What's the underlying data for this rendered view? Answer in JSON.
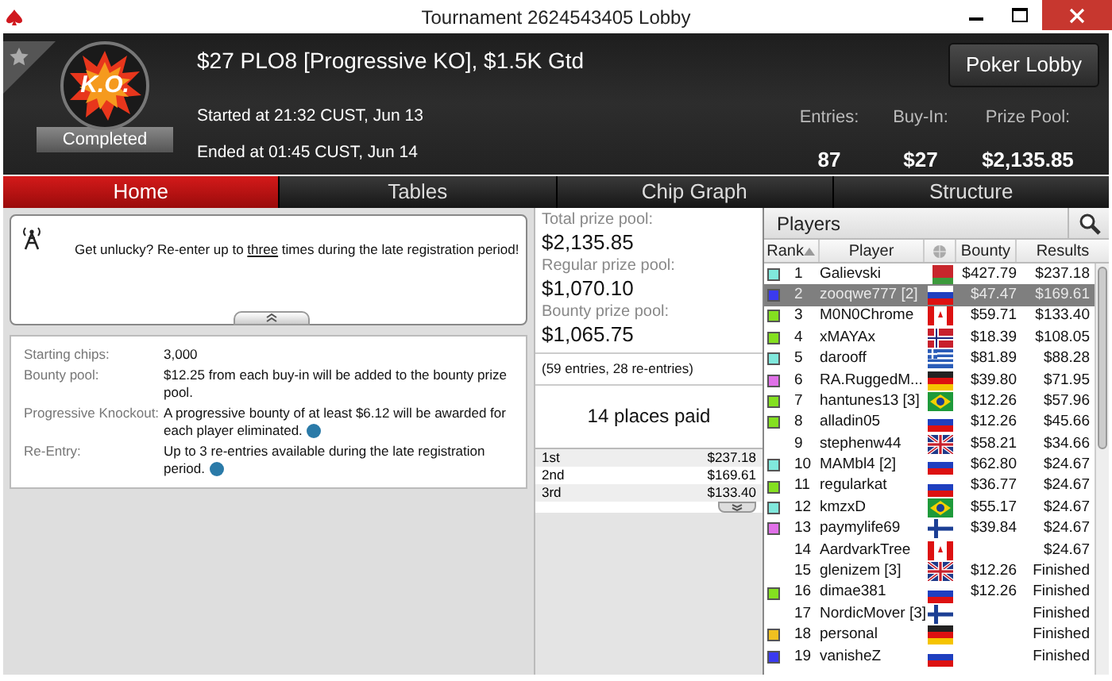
{
  "window": {
    "title": "Tournament 2624543405 Lobby"
  },
  "header": {
    "name": "$27 PLO8 [Progressive KO], $1.5K Gtd",
    "logo_text": "K.O.",
    "status": "Completed",
    "started": "Started at 21:32 CUST, Jun 13",
    "ended": "Ended at 01:45 CUST, Jun 14",
    "stats": [
      {
        "label": "Entries:",
        "value": "87"
      },
      {
        "label": "Buy-In:",
        "value": "$27"
      },
      {
        "label": "Prize Pool:",
        "value": "$2,135.85"
      }
    ],
    "button": "Poker Lobby"
  },
  "tabs": [
    {
      "label": "Home",
      "selected": true
    },
    {
      "label": "Tables",
      "selected": false
    },
    {
      "label": "Chip Graph",
      "selected": false
    },
    {
      "label": "Structure",
      "selected": false
    }
  ],
  "notice_parts": [
    "Get unlucky? Re-enter up to ",
    "three",
    " times during the late registration period!"
  ],
  "details": [
    {
      "label": "Starting chips:",
      "value": "3,000",
      "info": false
    },
    {
      "label": "Bounty pool:",
      "value": "$12.25 from each buy-in will be added to the bounty prize pool.",
      "info": false
    },
    {
      "label": "Progressive Knockout:",
      "value": "A progressive bounty of at least $6.12 will be awarded for each player eliminated.",
      "info": true
    },
    {
      "label": "Re-Entry:",
      "value": "Up to 3 re-entries available during the late registration period.",
      "info": true
    }
  ],
  "prizes": [
    {
      "label": "Total prize pool:",
      "value": "$2,135.85"
    },
    {
      "label": "Regular prize pool:",
      "value": "$1,070.10"
    },
    {
      "label": "Bounty prize pool:",
      "value": "$1,065.75"
    }
  ],
  "entries_note": "(59 entries, 28 re-entries)",
  "places_paid": "14 places paid",
  "payouts": [
    {
      "place": "1st",
      "amount": "$237.18"
    },
    {
      "place": "2nd",
      "amount": "$169.61"
    },
    {
      "place": "3rd",
      "amount": "$133.40"
    }
  ],
  "players": {
    "title": "Players",
    "columns": [
      "Rank",
      "Player",
      "Bounty",
      "Results"
    ],
    "rows": [
      {
        "rank": "1",
        "player": "Galievski",
        "kind": "by",
        "bounty": "$427.79",
        "result": "$237.18",
        "color": "#80e8dc",
        "selected": false
      },
      {
        "rank": "2",
        "player": "zooqwe777 [2]",
        "kind": "ru",
        "bounty": "$47.47",
        "result": "$169.61",
        "color": "#3a3af0",
        "selected": true
      },
      {
        "rank": "3",
        "player": "M0N0Chrome",
        "kind": "ca",
        "bounty": "$59.71",
        "result": "$133.40",
        "color": "#84e020",
        "selected": false
      },
      {
        "rank": "4",
        "player": "xMAYAx",
        "kind": "no",
        "bounty": "$18.39",
        "result": "$108.05",
        "color": "#84e020",
        "selected": false
      },
      {
        "rank": "5",
        "player": "darooff",
        "kind": "gr",
        "bounty": "$81.89",
        "result": "$88.28",
        "color": "#80e8dc",
        "selected": false
      },
      {
        "rank": "6",
        "player": "RA.RuggedM...",
        "kind": "de",
        "bounty": "$39.80",
        "result": "$71.95",
        "color": "#e070e8",
        "selected": false
      },
      {
        "rank": "7",
        "player": "hantunes13 [3]",
        "kind": "br",
        "bounty": "$12.26",
        "result": "$57.96",
        "color": "#84e020",
        "selected": false
      },
      {
        "rank": "8",
        "player": "alladin05",
        "kind": "ru",
        "bounty": "$12.26",
        "result": "$45.66",
        "color": "#84e020",
        "selected": false
      },
      {
        "rank": "9",
        "player": "stephenw44",
        "kind": "gb",
        "bounty": "$58.21",
        "result": "$34.66",
        "selected": false
      },
      {
        "rank": "10",
        "player": "MAMbl4 [2]",
        "kind": "ru",
        "bounty": "$62.80",
        "result": "$24.67",
        "color": "#80e8dc",
        "selected": false
      },
      {
        "rank": "11",
        "player": "regularkat",
        "kind": "ru",
        "bounty": "$36.77",
        "result": "$24.67",
        "color": "#84e020",
        "selected": false
      },
      {
        "rank": "12",
        "player": "kmzxD",
        "kind": "br",
        "bounty": "$55.17",
        "result": "$24.67",
        "color": "#80e8dc",
        "selected": false
      },
      {
        "rank": "13",
        "player": "paymylife69",
        "kind": "fi",
        "bounty": "$39.84",
        "result": "$24.67",
        "color": "#e070e8",
        "selected": false
      },
      {
        "rank": "14",
        "player": "AardvarkTree",
        "kind": "ca",
        "result": "$24.67",
        "selected": false
      },
      {
        "rank": "15",
        "player": "glenizem [3]",
        "kind": "gb",
        "bounty": "$12.26",
        "result": "Finished",
        "selected": false
      },
      {
        "rank": "16",
        "player": "dimae381",
        "kind": "ru",
        "bounty": "$12.26",
        "result": "Finished",
        "color": "#84e020",
        "selected": false
      },
      {
        "rank": "17",
        "player": "NordicMover [3]",
        "kind": "fi",
        "result": "Finished",
        "selected": false
      },
      {
        "rank": "18",
        "player": "personal",
        "kind": "de",
        "result": "Finished",
        "color": "#f0c020",
        "selected": false
      },
      {
        "rank": "19",
        "player": "vanisheZ",
        "kind": "ru",
        "result": "Finished",
        "color": "#3a3af0",
        "selected": false
      }
    ]
  }
}
